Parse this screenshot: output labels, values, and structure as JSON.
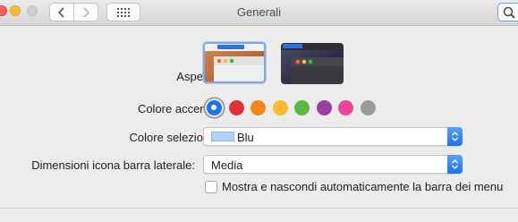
{
  "window": {
    "title": "Generali"
  },
  "toolbar": {
    "back_icon": "chevron-left-icon",
    "forward_icon": "chevron-right-icon",
    "grid_icon": "grid-icon",
    "search_icon": "search-icon"
  },
  "appearance": {
    "label": "Aspetto:",
    "options": [
      "light",
      "dark"
    ],
    "selected": "light"
  },
  "accent": {
    "label": "Colore accento:",
    "colors": [
      "#1a74f1",
      "#e0303a",
      "#f4851d",
      "#fbbc2f",
      "#5bb840",
      "#9b3ea2",
      "#ee4596",
      "#9b9b9b"
    ],
    "selected_index": 0
  },
  "highlight": {
    "label": "Colore selezione:",
    "value": "Blu",
    "swatch": "#b3d2fb"
  },
  "sidebar_icon": {
    "label": "Dimensioni icona barra laterale:",
    "value": "Media"
  },
  "autohide_menu": {
    "label": "Mostra e nascondi automaticamente la barra dei menu",
    "checked": false
  }
}
